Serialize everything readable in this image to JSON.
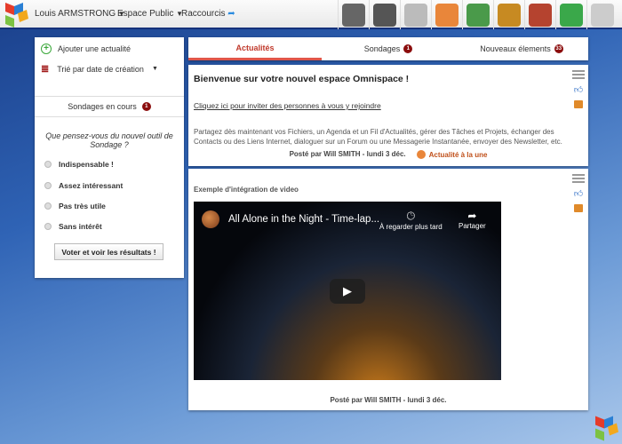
{
  "topbar": {
    "user": "Louis ARMSTRONG",
    "space": "Espace Public",
    "shortcuts": "Raccourcis",
    "apps": [
      {
        "name": "news-app-icon",
        "color": "#666"
      },
      {
        "name": "files-app-icon",
        "color": "#555"
      },
      {
        "name": "calendar-app-icon",
        "color": "#bbb"
      },
      {
        "name": "announce-app-icon",
        "color": "#e9863a"
      },
      {
        "name": "contacts-app-icon",
        "color": "#4a9a4a"
      },
      {
        "name": "links-app-icon",
        "color": "#c78a22"
      },
      {
        "name": "tasks-app-icon",
        "color": "#b5432f"
      },
      {
        "name": "messenger-app-icon",
        "color": "#3aa84a"
      },
      {
        "name": "mail-app-icon",
        "color": "#ccc"
      }
    ]
  },
  "left": {
    "add": "Ajouter une actualité",
    "sort": "Trié par date de création",
    "polls_title": "Sondages en cours",
    "polls_count": "1",
    "question": "Que pensez-vous du nouvel outil de Sondage ?",
    "options": [
      "Indispensable !",
      "Assez intéressant",
      "Pas très utile",
      "Sans intérêt"
    ],
    "vote": "Voter et voir les résultats !"
  },
  "tabs": [
    {
      "label": "Actualités"
    },
    {
      "label": "Sondages",
      "badge": "1"
    },
    {
      "label": "Nouveaux élements",
      "badge": "33"
    }
  ],
  "post1": {
    "title": "Bienvenue sur votre nouvel espace Omnispace !",
    "invite": "Cliquez ici pour inviter des personnes à vous y rejoindre",
    "body": "Partagez dès maintenant vos Fichiers, un Agenda et un Fil d'Actualités, gérer des Tâches et Projets, échanger des Contacts ou des Liens Internet, dialoguer sur un Forum ou une Messagerie Instantanée, envoyer des Newsletter, etc.",
    "posted": "Posté par Will SMITH - lundi 3 déc.",
    "featured": "Actualité à la une"
  },
  "post2": {
    "title": "Exemple d'intégration de video",
    "video_title": "All Alone in the Night - Time-lap...",
    "watch_later": "À regarder plus tard",
    "share": "Partager",
    "posted": "Posté par Will SMITH - lundi 3 déc."
  }
}
